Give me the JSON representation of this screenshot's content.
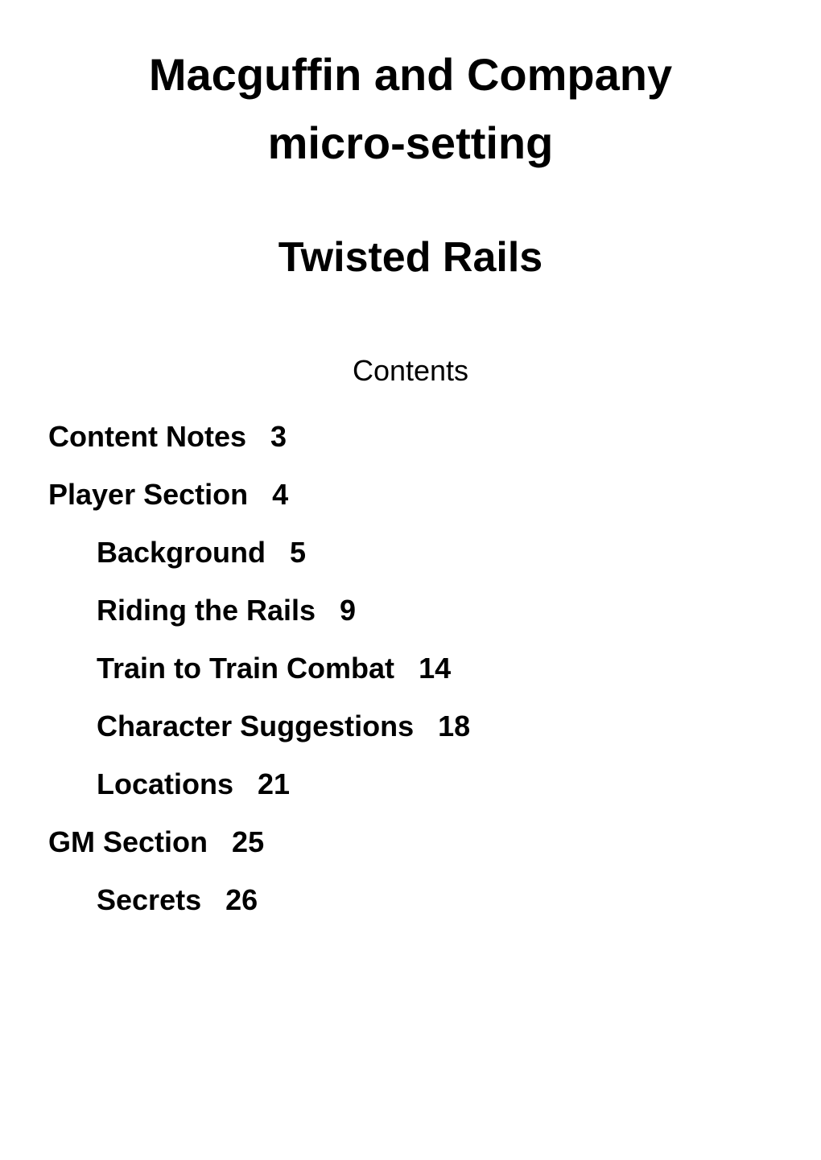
{
  "header": {
    "title_line1": "Macguffin and Company",
    "title_line2": "micro-setting",
    "subtitle": "Twisted Rails"
  },
  "contents_heading": "Contents",
  "toc": [
    {
      "level": 1,
      "title": "Content Notes",
      "page": "3"
    },
    {
      "level": 1,
      "title": "Player Section",
      "page": "4"
    },
    {
      "level": 2,
      "title": "Background",
      "page": "5"
    },
    {
      "level": 2,
      "title": "Riding the Rails",
      "page": "9"
    },
    {
      "level": 2,
      "title": "Train to Train Combat",
      "page": "14"
    },
    {
      "level": 2,
      "title": "Character Suggestions",
      "page": "18"
    },
    {
      "level": 2,
      "title": "Locations",
      "page": "21"
    },
    {
      "level": 1,
      "title": "GM Section",
      "page": "25"
    },
    {
      "level": 2,
      "title": "Secrets",
      "page": "26"
    }
  ]
}
